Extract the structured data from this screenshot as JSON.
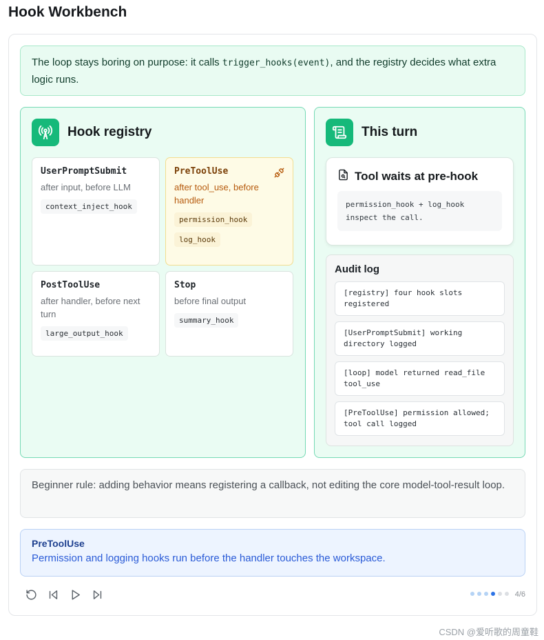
{
  "app": {
    "title": "Hook Workbench"
  },
  "intro": {
    "before": "The loop stays boring on purpose: it calls ",
    "code": "trigger_hooks(event)",
    "after": ", and the registry decides what extra logic runs."
  },
  "registry": {
    "title": "Hook registry",
    "hooks": [
      {
        "name": "UserPromptSubmit",
        "desc": "after input, before LLM",
        "chips": [
          "context_inject_hook"
        ]
      },
      {
        "name": "PreToolUse",
        "desc": "after tool_use, before handler",
        "chips": [
          "permission_hook",
          "log_hook"
        ]
      },
      {
        "name": "PostToolUse",
        "desc": "after handler, before next turn",
        "chips": [
          "large_output_hook"
        ]
      },
      {
        "name": "Stop",
        "desc": "before final output",
        "chips": [
          "summary_hook"
        ]
      }
    ]
  },
  "turn": {
    "title": "This turn",
    "waiting": {
      "title": "Tool waits at pre-hook",
      "line1": "permission_hook + log_hook",
      "line2": "inspect the call."
    },
    "audit": {
      "title": "Audit log",
      "entries": [
        "[registry] four hook slots registered",
        "[UserPromptSubmit] working directory logged",
        "[loop] model returned read_file tool_use",
        "[PreToolUse] permission allowed; tool call logged"
      ]
    }
  },
  "rule": {
    "text": "Beginner rule: adding behavior means registering a callback, not editing the core model-tool-result loop."
  },
  "status": {
    "title": "PreToolUse",
    "text": "Permission and logging hooks run before the handler touches the workspace."
  },
  "player": {
    "current_step": 4,
    "total_steps": 6,
    "page_label": "4/6"
  },
  "watermark": "CSDN @爱听歌的周童鞋",
  "colors": {
    "accent_green": "#16b97a",
    "active_yellow": "#fefbe6",
    "status_blue": "#2a5bd7"
  },
  "icons": {
    "registry": "antenna-icon",
    "turn": "scroll-icon",
    "active_hook": "plug-icon",
    "waiting": "file-search-icon",
    "controls": [
      "restart-icon",
      "prev-icon",
      "play-icon",
      "next-icon"
    ]
  }
}
